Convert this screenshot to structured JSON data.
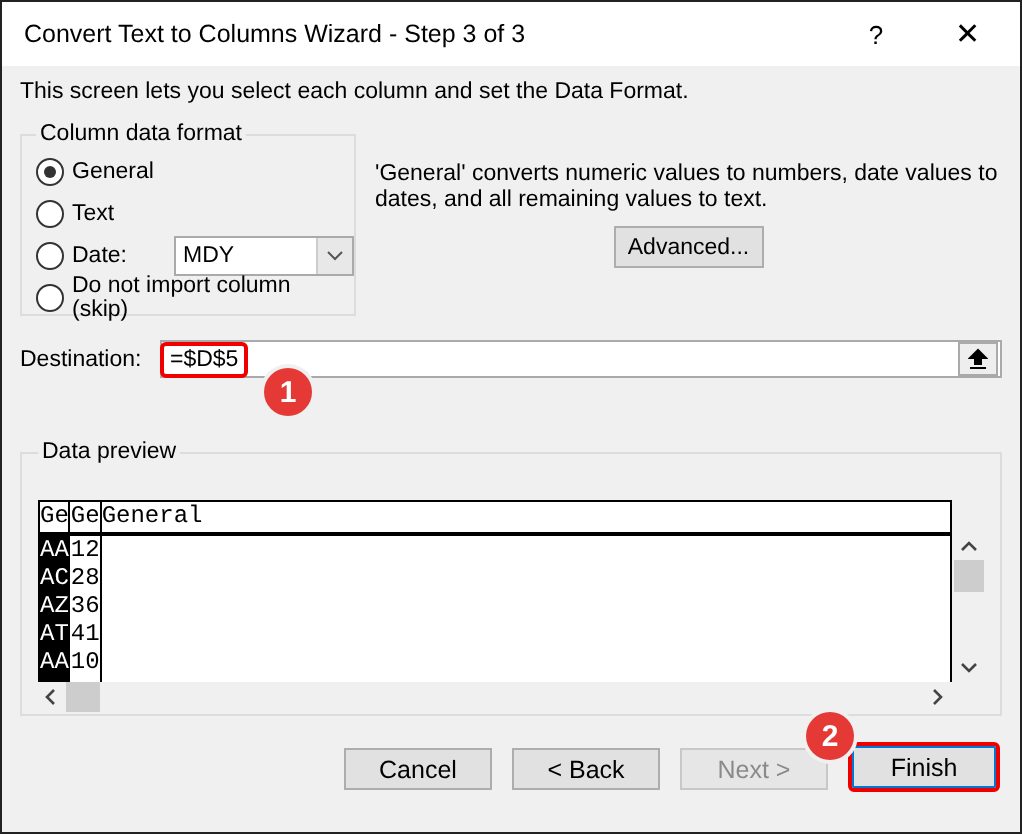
{
  "window": {
    "title": "Convert Text to Columns Wizard - Step 3 of 3",
    "help": "?",
    "close": "✕"
  },
  "intro": "This screen lets you select each column and set the Data Format.",
  "column_format": {
    "legend": "Column data format",
    "options": [
      {
        "label": "General",
        "selected": true,
        "kind": "plain"
      },
      {
        "label": "Text",
        "selected": false,
        "kind": "plain"
      },
      {
        "label": "Date:",
        "selected": false,
        "kind": "date",
        "value": "MDY"
      },
      {
        "label": "Do not import column (skip)",
        "selected": false,
        "kind": "plain"
      }
    ],
    "description": "'General' converts numeric values to numbers, date values to dates, and all remaining values to text.",
    "advanced_button": "Advanced..."
  },
  "destination": {
    "label": "Destination:",
    "value": "=$D$5",
    "highlighted": true,
    "badge": "1"
  },
  "data_preview": {
    "legend": "Data preview",
    "columns": [
      {
        "header": "Ge",
        "selected": true
      },
      {
        "header": "Ge",
        "selected": false
      },
      {
        "header": "General",
        "selected": false
      }
    ],
    "rows": [
      [
        "AA",
        "12"
      ],
      [
        "AC",
        "28"
      ],
      [
        "AZ",
        "36"
      ],
      [
        "AT",
        "41"
      ],
      [
        "AA",
        "10"
      ]
    ]
  },
  "buttons": [
    {
      "label": "Cancel",
      "disabled": false,
      "highlighted": false
    },
    {
      "label": "< Back",
      "disabled": false,
      "highlighted": false
    },
    {
      "label": "Next >",
      "disabled": true,
      "highlighted": false
    },
    {
      "label": "Finish",
      "disabled": false,
      "highlighted": true,
      "badge": "2"
    }
  ]
}
